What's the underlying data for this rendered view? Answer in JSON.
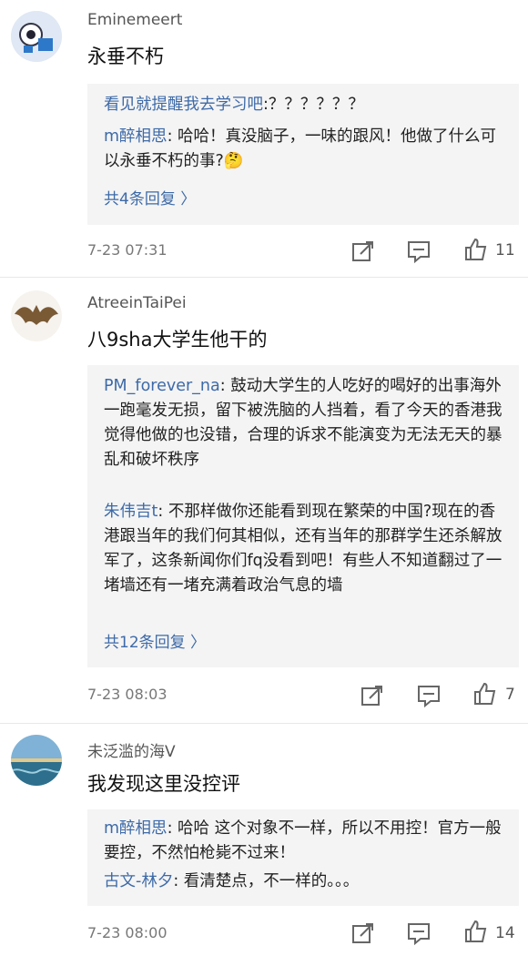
{
  "comments": [
    {
      "user": "Eminemeert",
      "text": "永垂不朽",
      "avatar": "avatar-cartoon",
      "replies": [
        {
          "who": "看见就提醒我去学习吧",
          "text": ":？？？？？？"
        },
        {
          "who": "m醉相思",
          "text": ": 哈哈！真没脑子，一味的跟风！他做了什么可以永垂不朽的事?",
          "emoji": "🤔"
        }
      ],
      "more": "共4条回复 〉",
      "date": "7-23 07:31",
      "likes": "11"
    },
    {
      "user": "AtreeinTaiPei",
      "text": "八9sha大学生他干的",
      "avatar": "avatar-bat",
      "replies": [
        {
          "who": "PM_forever_na",
          "text": ": 鼓动大学生的人吃好的喝好的出事海外一跑毫发无损，留下被洗脑的人挡着，看了今天的香港我觉得他做的也没错，合理的诉求不能演变为无法无天的暴乱和破坏秩序"
        },
        {
          "who": "朱伟吉t",
          "text": ": 不那样做你还能看到现在繁荣的中国?现在的香港跟当年的我们何其相似，还有当年的那群学生还杀解放军了，这条新闻你们fq没看到吧！有些人不知道翻过了一堵墙还有一堵充满着政治气息的墙"
        }
      ],
      "more": "共12条回复 〉",
      "date": "7-23 08:03",
      "likes": "7"
    },
    {
      "user": "未泛滥的海V",
      "text": "我发现这里没控评",
      "avatar": "avatar-sea",
      "replies": [
        {
          "who": "m醉相思",
          "text": ": 哈哈 这个对象不一样，所以不用控！官方一般要控，不然怕枪毙不过来！"
        },
        {
          "who": "古文-林夕",
          "text": ": 看清楚点，不一样的。。。"
        }
      ],
      "more": "",
      "date": "7-23 08:00",
      "likes": "14"
    }
  ]
}
